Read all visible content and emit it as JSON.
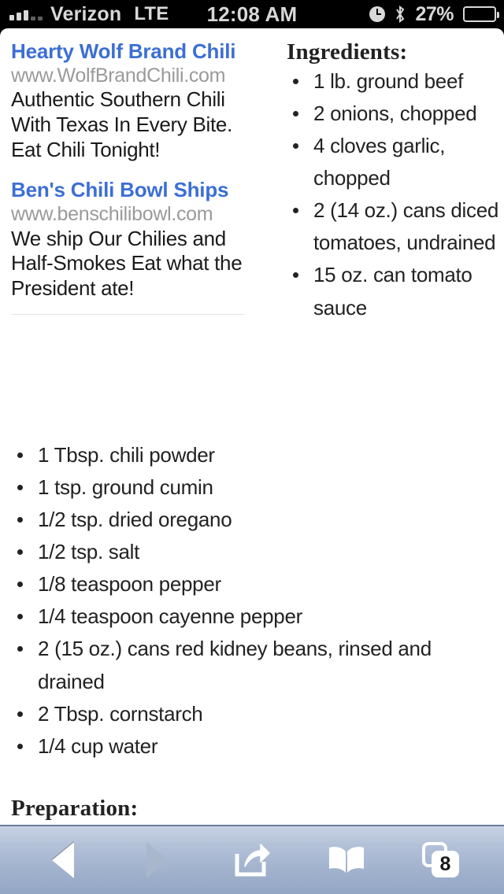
{
  "status_bar": {
    "carrier": "Verizon",
    "network": "LTE",
    "time": "12:08 AM",
    "battery_percent": "27%",
    "signal_icon": "signal-bars-icon",
    "alarm_icon": "alarm-clock-icon",
    "bluetooth_icon": "bluetooth-icon",
    "battery_icon": "battery-icon"
  },
  "ads": [
    {
      "title": "Hearty Wolf Brand Chili",
      "url": "www.WolfBrandChili.com",
      "description": "Authentic Southern Chili With Texas In Every Bite. Eat Chili Tonight!"
    },
    {
      "title": "Ben's Chili Bowl Ships",
      "url": "www.benschilibowl.com",
      "description": "We ship Our Chilies and Half-Smokes Eat what the President ate!"
    }
  ],
  "ingredients": {
    "heading": "Ingredients:",
    "items": [
      "1 lb. ground beef",
      "2 onions, chopped",
      "4 cloves garlic, chopped",
      "2 (14 oz.) cans diced tomatoes, undrained",
      "15 oz. can tomato sauce"
    ]
  },
  "ingredients_continued": {
    "items": [
      "1 Tbsp. chili powder",
      "1 tsp. ground cumin",
      "1/2 tsp. dried oregano",
      "1/2 tsp. salt",
      "1/8 teaspoon pepper",
      "1/4 teaspoon cayenne pepper",
      "2 (15 oz.) cans red kidney beans, rinsed and drained",
      "2 Tbsp. cornstarch",
      "1/4 cup water"
    ]
  },
  "preparation": {
    "heading": "Preparation:"
  },
  "toolbar": {
    "back_icon": "back-arrow-icon",
    "forward_icon": "forward-arrow-icon",
    "share_icon": "share-icon",
    "bookmarks_icon": "book-icon",
    "tabs_icon": "tabs-icon",
    "tab_count": "8"
  },
  "colors": {
    "link": "#3c6fd4",
    "url_grey": "#9a9a9a",
    "text": "#222222",
    "toolbar_top": "#c7d2e3",
    "toolbar_bottom": "#93a6c4",
    "status_bar_bg": "#000000"
  }
}
